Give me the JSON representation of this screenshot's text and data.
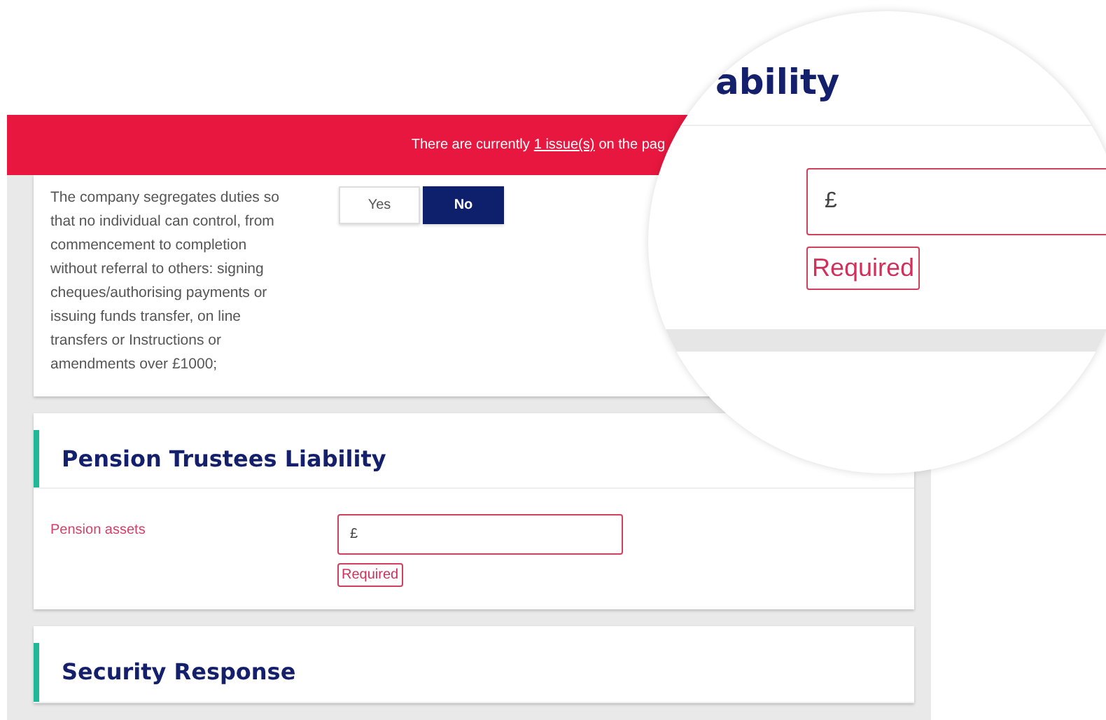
{
  "banner": {
    "prefix": "There are currently ",
    "link": "1 issue(s)",
    "suffix": " on the pag"
  },
  "question": {
    "text": "The company segregates duties so that no individual can control, from commencement to completion without referral to others: signing cheques/authorising payments or issuing funds transfer, on line transfers or Instructions or amendments over £1000;",
    "options": [
      {
        "label": "Yes",
        "selected": false
      },
      {
        "label": "No",
        "selected": true
      }
    ]
  },
  "sections": [
    {
      "title": "Pension Trustees Liability",
      "field": {
        "label": "Pension assets",
        "value": "£",
        "error": "Required"
      }
    },
    {
      "title": "Security Response"
    }
  ],
  "magnifier": {
    "heading": "ability",
    "value": "£",
    "error": "Required"
  }
}
